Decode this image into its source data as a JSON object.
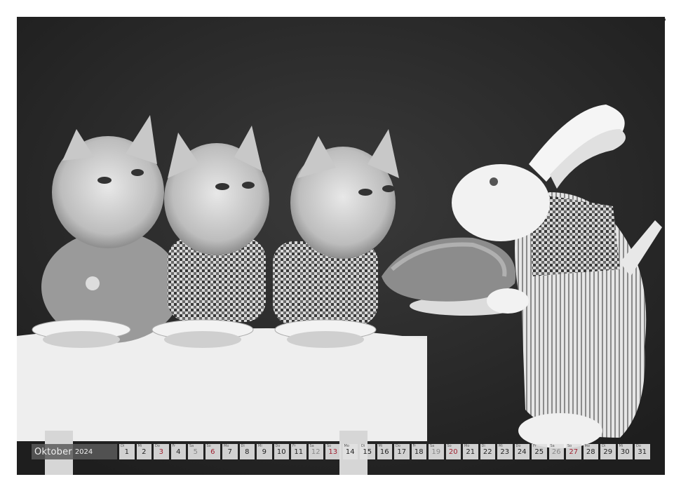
{
  "calendar": {
    "month": "Oktober",
    "year": "2024",
    "days": [
      {
        "dow": "Di",
        "num": "1",
        "type": "weekday"
      },
      {
        "dow": "Mi",
        "num": "2",
        "type": "weekday"
      },
      {
        "dow": "Do",
        "num": "3",
        "type": "holiday"
      },
      {
        "dow": "Fr",
        "num": "4",
        "type": "weekday"
      },
      {
        "dow": "Sa",
        "num": "5",
        "type": "weekend"
      },
      {
        "dow": "So",
        "num": "6",
        "type": "holiday"
      },
      {
        "dow": "Mo",
        "num": "7",
        "type": "weekday"
      },
      {
        "dow": "Di",
        "num": "8",
        "type": "weekday"
      },
      {
        "dow": "Mi",
        "num": "9",
        "type": "weekday"
      },
      {
        "dow": "Do",
        "num": "10",
        "type": "weekday"
      },
      {
        "dow": "Fr",
        "num": "11",
        "type": "weekday"
      },
      {
        "dow": "Sa",
        "num": "12",
        "type": "weekend"
      },
      {
        "dow": "So",
        "num": "13",
        "type": "holiday"
      },
      {
        "dow": "Mo",
        "num": "14",
        "type": "weekday"
      },
      {
        "dow": "Di",
        "num": "15",
        "type": "weekday"
      },
      {
        "dow": "Mi",
        "num": "16",
        "type": "weekday"
      },
      {
        "dow": "Do",
        "num": "17",
        "type": "weekday"
      },
      {
        "dow": "Fr",
        "num": "18",
        "type": "weekday"
      },
      {
        "dow": "Sa",
        "num": "19",
        "type": "weekend"
      },
      {
        "dow": "So",
        "num": "20",
        "type": "holiday"
      },
      {
        "dow": "Mo",
        "num": "21",
        "type": "weekday"
      },
      {
        "dow": "Di",
        "num": "22",
        "type": "weekday"
      },
      {
        "dow": "Mi",
        "num": "23",
        "type": "weekday"
      },
      {
        "dow": "Do",
        "num": "24",
        "type": "weekday"
      },
      {
        "dow": "Fr",
        "num": "25",
        "type": "weekday"
      },
      {
        "dow": "Sa",
        "num": "26",
        "type": "weekend"
      },
      {
        "dow": "So",
        "num": "27",
        "type": "holiday"
      },
      {
        "dow": "Mo",
        "num": "28",
        "type": "weekday"
      },
      {
        "dow": "Di",
        "num": "29",
        "type": "weekday"
      },
      {
        "dow": "Mi",
        "num": "30",
        "type": "weekday"
      },
      {
        "dow": "Do",
        "num": "31",
        "type": "weekday"
      }
    ]
  },
  "colors": {
    "holiday": "#a02030",
    "weekend": "#888888",
    "month_bar": "#5a5a5a"
  }
}
